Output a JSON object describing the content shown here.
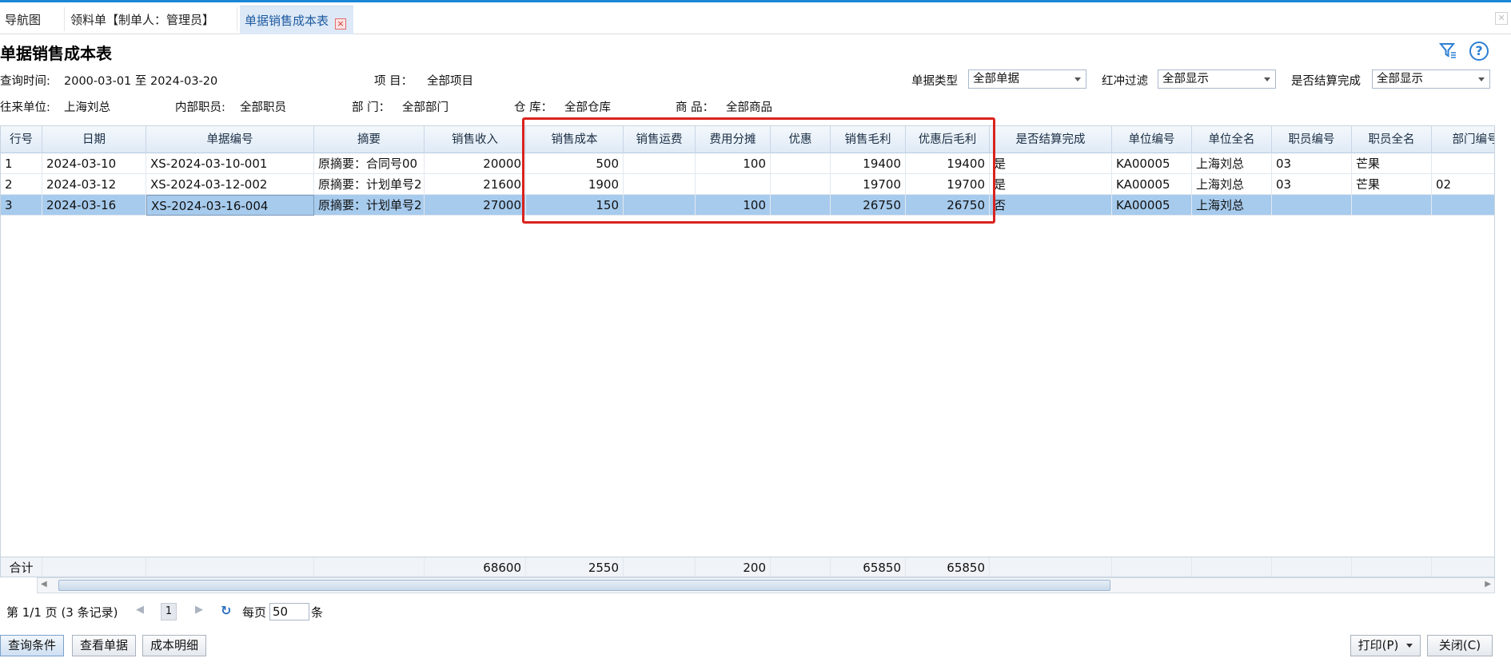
{
  "tabs": [
    {
      "label": "导航图"
    },
    {
      "label": "领料单【制单人：管理员】"
    },
    {
      "label": "单据销售成本表",
      "close": "×"
    }
  ],
  "page_title": "单据销售成本表",
  "filters": {
    "query_time_label": "查询时间:",
    "query_time_value": "2000-03-01 至 2024-03-20",
    "project_label": "项 目：",
    "project_value": "全部项目",
    "doc_type_label": "单据类型",
    "doc_type_value": "全部单据",
    "red_filter_label": "红冲过滤",
    "red_filter_value": "全部显示",
    "settled_label": "是否结算完成",
    "settled_value": "全部显示",
    "partner_label": "往来单位:",
    "partner_value": "上海刘总",
    "staff_label": "内部职员:",
    "staff_value": "全部职员",
    "dept_label": "部 门：",
    "dept_value": "全部部门",
    "warehouse_label": "仓 库：",
    "warehouse_value": "全部仓库",
    "goods_label": "商 品：",
    "goods_value": "全部商品"
  },
  "columns": [
    "行号",
    "日期",
    "单据编号",
    "摘要",
    "销售收入",
    "销售成本",
    "销售运费",
    "费用分摊",
    "优惠",
    "销售毛利",
    "优惠后毛利",
    "是否结算完成",
    "单位编号",
    "单位全名",
    "职员编号",
    "职员全名",
    "部门编号"
  ],
  "rows": [
    [
      "1",
      "2024-03-10",
      "XS-2024-03-10-001",
      "原摘要：合同号00",
      "20000",
      "500",
      "",
      "100",
      "",
      "19400",
      "19400",
      "是",
      "KA00005",
      "上海刘总",
      "03",
      "芒果",
      ""
    ],
    [
      "2",
      "2024-03-12",
      "XS-2024-03-12-002",
      "原摘要：计划单号2",
      "21600",
      "1900",
      "",
      "",
      "",
      "19700",
      "19700",
      "是",
      "KA00005",
      "上海刘总",
      "03",
      "芒果",
      "02"
    ],
    [
      "3",
      "2024-03-16",
      "XS-2024-03-16-004",
      "原摘要：计划单号2",
      "27000",
      "150",
      "",
      "100",
      "",
      "26750",
      "26750",
      "否",
      "KA00005",
      "上海刘总",
      "",
      "",
      ""
    ]
  ],
  "selected_row": 3,
  "totals": [
    "合计",
    "",
    "",
    "",
    "68600",
    "2550",
    "",
    "200",
    "",
    "65850",
    "65850",
    "",
    "",
    "",
    "",
    "",
    ""
  ],
  "pager": {
    "info": "第 1/1 页 (3 条记录)",
    "current_page": "1",
    "per_page_label": "每页",
    "per_page_value": "50",
    "per_page_unit": "条"
  },
  "buttons": {
    "query": "查询条件",
    "view_doc": "查看单据",
    "cost_detail": "成本明细",
    "print": "打印(P)",
    "close": "关闭(C)"
  },
  "colors": {
    "accent": "#1a86d6",
    "selected_row": "#a7cbed",
    "highlight": "#d9231f"
  },
  "icons": {
    "filter": "filter-icon",
    "help": "help-icon",
    "refresh": "refresh-icon"
  }
}
